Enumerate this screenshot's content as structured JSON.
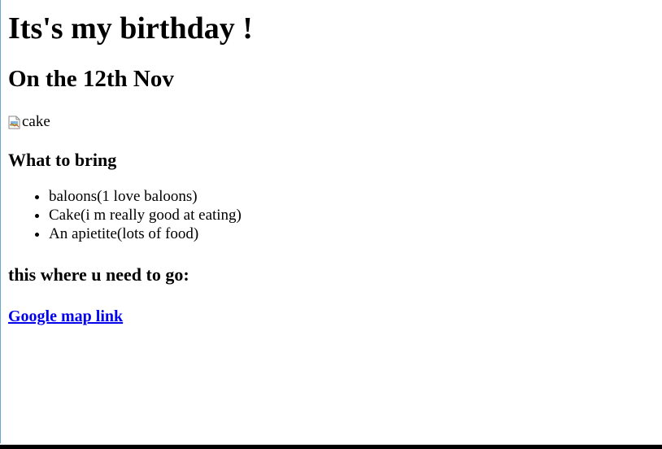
{
  "page": {
    "title": "Its's my birthday !",
    "subtitle": "On the 12th Nov",
    "image_alt": "cake",
    "bring_heading": "What to bring",
    "bring_items": [
      "baloons(1 love baloons)",
      "Cake(i m really good at eating)",
      "An apietite(lots of food)"
    ],
    "go_heading": "this where u need to go:",
    "map_link_text": "Google map link"
  },
  "colors": {
    "link": "#0000ee",
    "text": "#000000",
    "background": "#ffffff"
  },
  "icons": {
    "broken_image": "broken-image-icon"
  }
}
